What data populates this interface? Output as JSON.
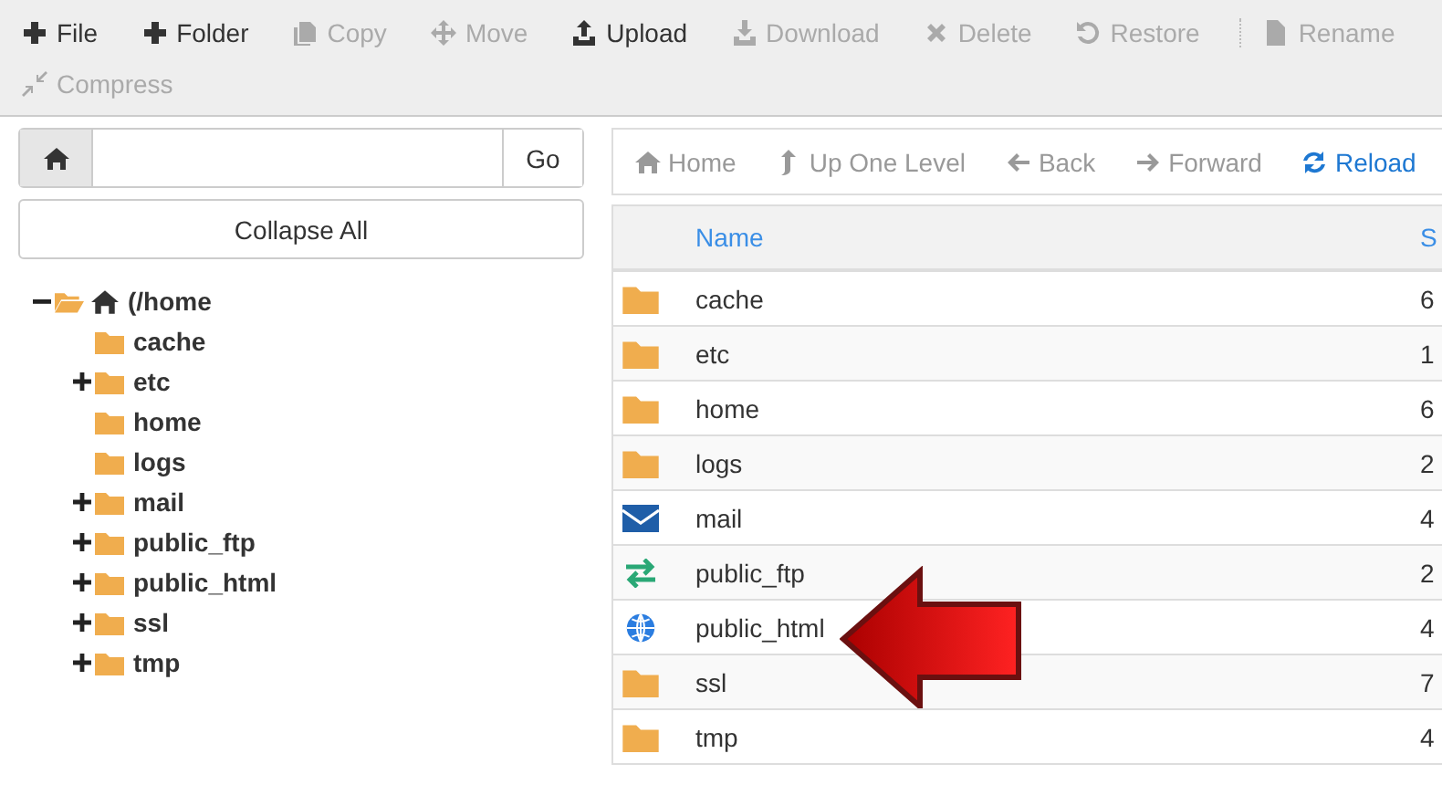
{
  "toolbar": {
    "rows": [
      {
        "items": [
          {
            "kind": "plus",
            "label": "File",
            "disabled": false,
            "group_start": false
          },
          {
            "kind": "plus",
            "label": "Folder",
            "disabled": false,
            "group_start": false
          },
          {
            "kind": "copy",
            "label": "Copy",
            "disabled": true,
            "group_start": false
          },
          {
            "kind": "move",
            "label": "Move",
            "disabled": true,
            "group_start": false
          },
          {
            "kind": "upload",
            "label": "Upload",
            "disabled": false,
            "group_start": false
          },
          {
            "kind": "download",
            "label": "Download",
            "disabled": true,
            "group_start": false
          },
          {
            "kind": "delete",
            "label": "Delete",
            "disabled": true,
            "group_start": false
          },
          {
            "kind": "restore",
            "label": "Restore",
            "disabled": true,
            "group_start": false
          },
          {
            "kind": "file",
            "label": "Rename",
            "disabled": true,
            "group_start": true
          }
        ]
      },
      {
        "items": [
          {
            "kind": "compress",
            "label": "Compress",
            "disabled": true,
            "group_start": false
          }
        ]
      }
    ]
  },
  "path_bar": {
    "button": "Go"
  },
  "collapse_button": "Collapse All",
  "tree": {
    "label": "(/home",
    "expandable": true,
    "expanded": true,
    "children": [
      {
        "label": "cache",
        "expandable": false,
        "expanded": false
      },
      {
        "label": "etc",
        "expandable": true,
        "expanded": false
      },
      {
        "label": "home",
        "expandable": false,
        "expanded": false
      },
      {
        "label": "logs",
        "expandable": false,
        "expanded": false
      },
      {
        "label": "mail",
        "expandable": true,
        "expanded": false
      },
      {
        "label": "public_ftp",
        "expandable": true,
        "expanded": false
      },
      {
        "label": "public_html",
        "expandable": true,
        "expanded": false
      },
      {
        "label": "ssl",
        "expandable": true,
        "expanded": false
      },
      {
        "label": "tmp",
        "expandable": true,
        "expanded": false
      }
    ]
  },
  "nav": [
    {
      "kind": "home",
      "label": "Home",
      "disabled": true
    },
    {
      "kind": "up",
      "label": "Up One Level",
      "disabled": true
    },
    {
      "kind": "back",
      "label": "Back",
      "disabled": true
    },
    {
      "kind": "forward",
      "label": "Forward",
      "disabled": true
    },
    {
      "kind": "reload",
      "label": "Reload",
      "disabled": false
    }
  ],
  "table": {
    "columns": [
      "Name",
      "S"
    ],
    "rows": [
      {
        "kind": "folder",
        "name": "cache",
        "column_2": "6"
      },
      {
        "kind": "folder",
        "name": "etc",
        "column_2": "1"
      },
      {
        "kind": "folder",
        "name": "home",
        "column_2": "6"
      },
      {
        "kind": "folder",
        "name": "logs",
        "column_2": "2"
      },
      {
        "kind": "mail",
        "name": "mail",
        "column_2": "4"
      },
      {
        "kind": "transfer",
        "name": "public_ftp",
        "column_2": "2"
      },
      {
        "kind": "globe",
        "name": "public_html",
        "column_2": "4"
      },
      {
        "kind": "folder",
        "name": "ssl",
        "column_2": "7"
      },
      {
        "kind": "folder",
        "name": "tmp",
        "column_2": "4"
      }
    ]
  }
}
